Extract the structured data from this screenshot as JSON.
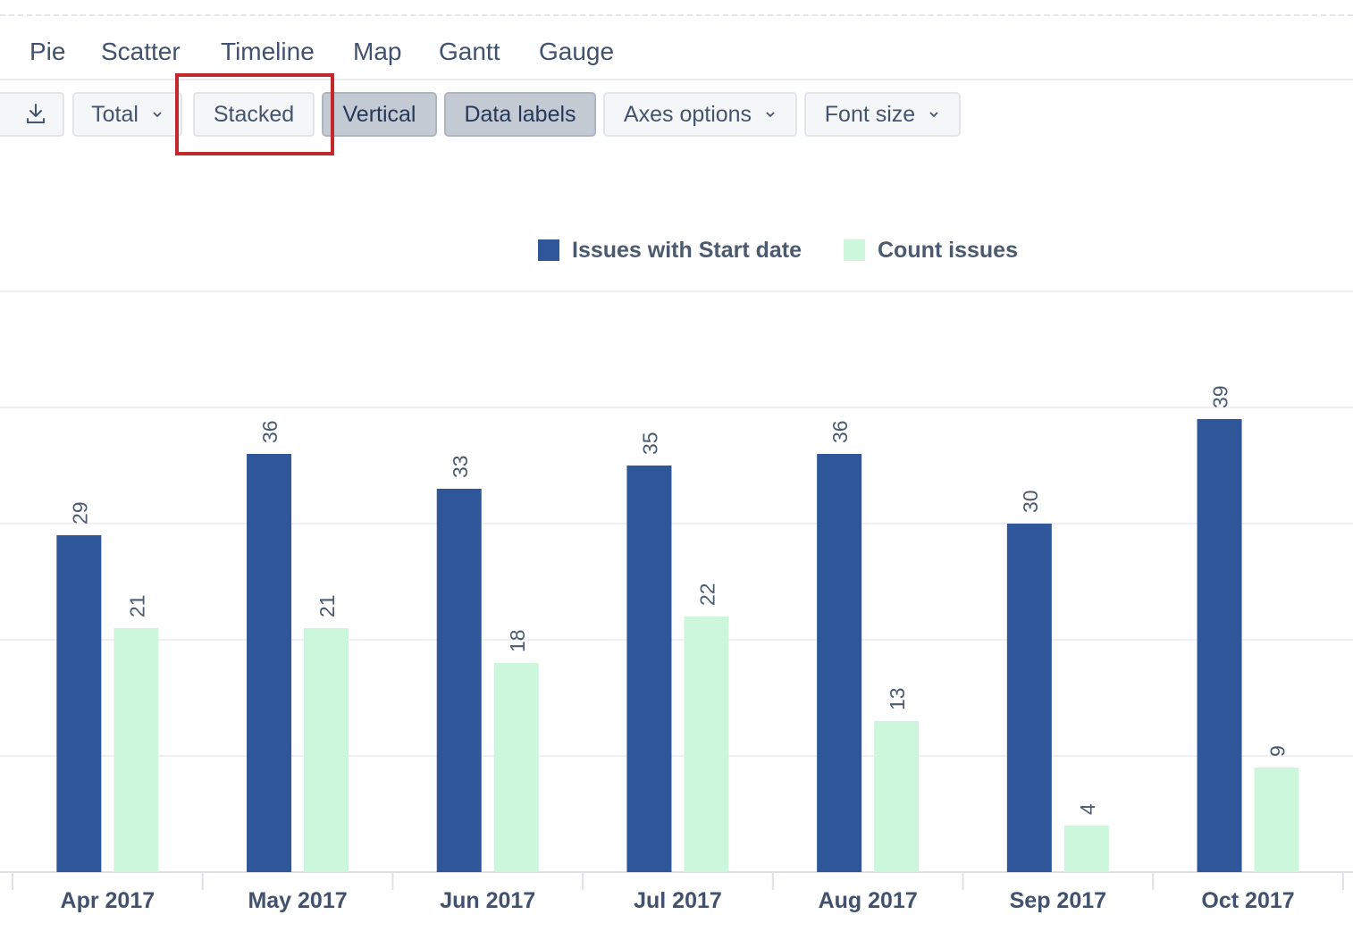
{
  "chart_tabs": [
    "Pie",
    "Scatter",
    "Timeline",
    "Map",
    "Gantt",
    "Gauge"
  ],
  "toolbar": {
    "download_icon": "download-icon",
    "total_label": "Total",
    "stacked_label": "Stacked",
    "vertical_label": "Vertical",
    "data_labels_label": "Data labels",
    "axes_options_label": "Axes options",
    "font_size_label": "Font size",
    "dropdown_icon": "chevron-down-icon"
  },
  "colors": {
    "series1": "#2e5698",
    "series2": "#cdf7dc",
    "highlight": "#c0282d",
    "grid": "#ebecf0"
  },
  "chart_data": {
    "type": "bar",
    "categories": [
      "Apr 2017",
      "May 2017",
      "Jun 2017",
      "Jul 2017",
      "Aug 2017",
      "Sep 2017",
      "Oct 2017"
    ],
    "series": [
      {
        "name": "Issues with Start date",
        "values": [
          29,
          36,
          33,
          35,
          36,
          30,
          39
        ]
      },
      {
        "name": "Count issues",
        "values": [
          21,
          21,
          18,
          22,
          13,
          4,
          9
        ]
      }
    ],
    "ylim": [
      0,
      50
    ],
    "grid": true,
    "legend": "top",
    "data_labels": true,
    "orientation": "vertical"
  }
}
